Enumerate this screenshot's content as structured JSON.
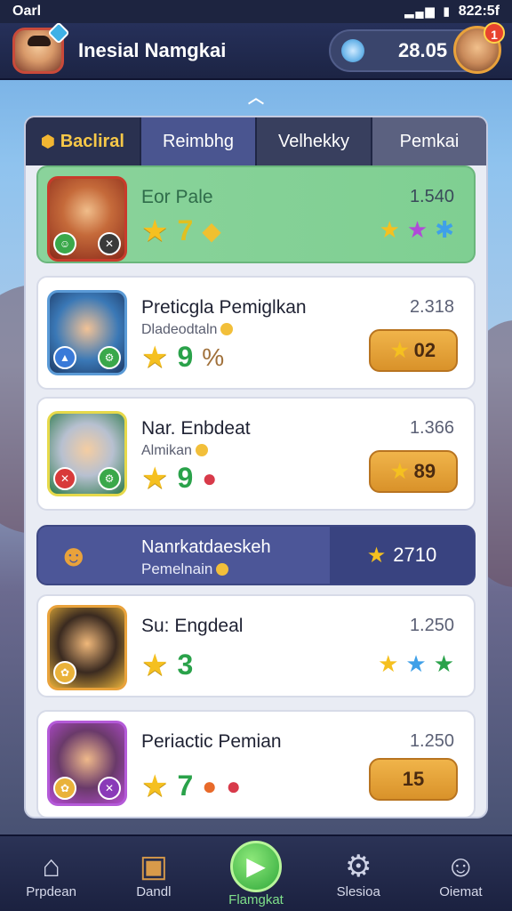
{
  "status_bar": {
    "carrier": "Oarl",
    "time": "822:5f"
  },
  "header": {
    "player_name": "Inesial Namgkai",
    "currency_amount": "28.05",
    "notification_count": "1"
  },
  "tabs": [
    {
      "label": "Bacliral"
    },
    {
      "label": "Reimbhg"
    },
    {
      "label": "Velhekky"
    },
    {
      "label": "Pemkai"
    }
  ],
  "rows": [
    {
      "name": "Eor Pale",
      "score": "1.540",
      "stats": [
        "★",
        "7",
        "◆"
      ],
      "right_icons": [
        "★",
        "★",
        "✱"
      ]
    },
    {
      "name": "Preticgla Pemiglkan",
      "subtitle": "Dladeodtaln",
      "score": "2.318",
      "stats": [
        "★",
        "9",
        "%"
      ],
      "pill": "02"
    },
    {
      "name": "Nar. Enbdeat",
      "subtitle": "Almikan",
      "score": "1.366",
      "stats": [
        "★",
        "9",
        "●"
      ],
      "pill": "89"
    },
    {
      "name": "Su: Engdeal",
      "score": "1.250",
      "stats": [
        "★",
        "3"
      ],
      "right_icons": [
        "★",
        "★",
        "★"
      ]
    },
    {
      "name": "Periactic Pemian",
      "score": "1.250",
      "stats": [
        "★",
        "7",
        "●",
        "●"
      ],
      "pill": "15"
    }
  ],
  "team": {
    "name": "Nanrkatdaeskeh",
    "subtitle": "Pemelnain",
    "score": "2710"
  },
  "nav": [
    {
      "label": "Prpdean"
    },
    {
      "label": "Dandl"
    },
    {
      "label": "Flamgkat"
    },
    {
      "label": "Slesioa"
    },
    {
      "label": "Oiemat"
    }
  ],
  "colors": {
    "accent_green": "#7fcf92",
    "gold": "#f0b44a",
    "panel_dark": "#2c3458"
  }
}
